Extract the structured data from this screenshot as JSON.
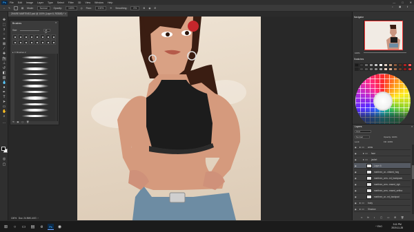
{
  "app": {
    "name": "Ps",
    "menus": [
      "File",
      "Edit",
      "Image",
      "Layer",
      "Type",
      "Select",
      "Filter",
      "3D",
      "View",
      "Window",
      "Help"
    ],
    "window_controls": [
      "—",
      "□",
      "✕"
    ]
  },
  "options": {
    "mode_label": "Mode:",
    "mode_value": "Normal",
    "opacity_label": "Opacity:",
    "opacity_value": "100%",
    "flow_label": "Flow:",
    "flow_value": "100%",
    "smoothing_label": "Smoothing:",
    "smoothing_value": "0%"
  },
  "document": {
    "tab_title": "ZHARE MARTINEZ.psd @ 100% (Layer 6, RGB/8) *",
    "close": "×"
  },
  "status": {
    "zoom": "100%",
    "doc_size": "Doc: 24.9M/1.40G",
    "arrow": "›"
  },
  "brushes_panel": {
    "title": "Brushes",
    "size_label": "Size:",
    "size_value": "28 px",
    "folder_label": "Brushes 2",
    "footer_icons": [
      "⟲",
      "▣",
      "▢",
      "🗑"
    ]
  },
  "navigator": {
    "tab_label": "Navigator",
    "zoom": "100%"
  },
  "swatches": {
    "tab_label": "Swatches",
    "colors": [
      "#1a1a1a",
      "#3a3a3a",
      "#6a6a6a",
      "#9a9a9a",
      "#c8c8c8",
      "#ffffff",
      "#e0d0c4",
      "#c49a7c",
      "#8c5a3c",
      "#5a3020",
      "#b22222",
      "#ff5555",
      "#222222",
      "#444444",
      "#555555",
      "#777777",
      "#888888",
      "#aaaaaa",
      "#f2d9c8",
      "#d9b39a",
      "#a46d4d",
      "#6e3d28",
      "#8a1a1a",
      "#cc3333"
    ]
  },
  "layers": {
    "tab_label": "Layers",
    "kind_label": "Kind",
    "blend_mode": "Normal",
    "opacity_label": "Opacity: 100%",
    "lock_label": "Lock:",
    "fill_label": "Fill: 100%",
    "items": [
      {
        "name": "arms",
        "type": "folder",
        "indent": 0
      },
      {
        "name": "face",
        "type": "folder",
        "indent": 1
      },
      {
        "name": "jacket",
        "type": "folder",
        "indent": 1
      },
      {
        "name": "Layer 6",
        "type": "layer",
        "indent": 2,
        "active": true
      },
      {
        "name": "martinez_ar...shtaed_hag",
        "type": "layer",
        "indent": 2
      },
      {
        "name": "martinez_arm...ed_backpack",
        "type": "layer",
        "indent": 2
      },
      {
        "name": "martinez_arm...eased_righ",
        "type": "layer",
        "indent": 2
      },
      {
        "name": "martinez_arm...eased_sefina",
        "type": "layer",
        "indent": 2
      },
      {
        "name": "martinez_ar...ed_backpad",
        "type": "layer",
        "indent": 2
      },
      {
        "name": "body",
        "type": "folder",
        "indent": 0
      },
      {
        "name": "Shadow",
        "type": "folder",
        "indent": 0
      }
    ],
    "footer_icons": [
      "fx",
      "◐",
      "▢",
      "▭",
      "⊞",
      "🗑"
    ]
  },
  "taskbar": {
    "icons": [
      {
        "name": "start",
        "glyph": "⊞"
      },
      {
        "name": "search",
        "glyph": "○"
      },
      {
        "name": "task-view",
        "glyph": "▭"
      },
      {
        "name": "file-explorer",
        "glyph": "▤"
      },
      {
        "name": "edge",
        "glyph": "e"
      },
      {
        "name": "photoshop",
        "glyph": "Ps"
      },
      {
        "name": "obs",
        "glyph": "◉"
      }
    ],
    "tray": "^  ENG",
    "time": "3:11 PM",
    "date": "2019-11-28"
  }
}
